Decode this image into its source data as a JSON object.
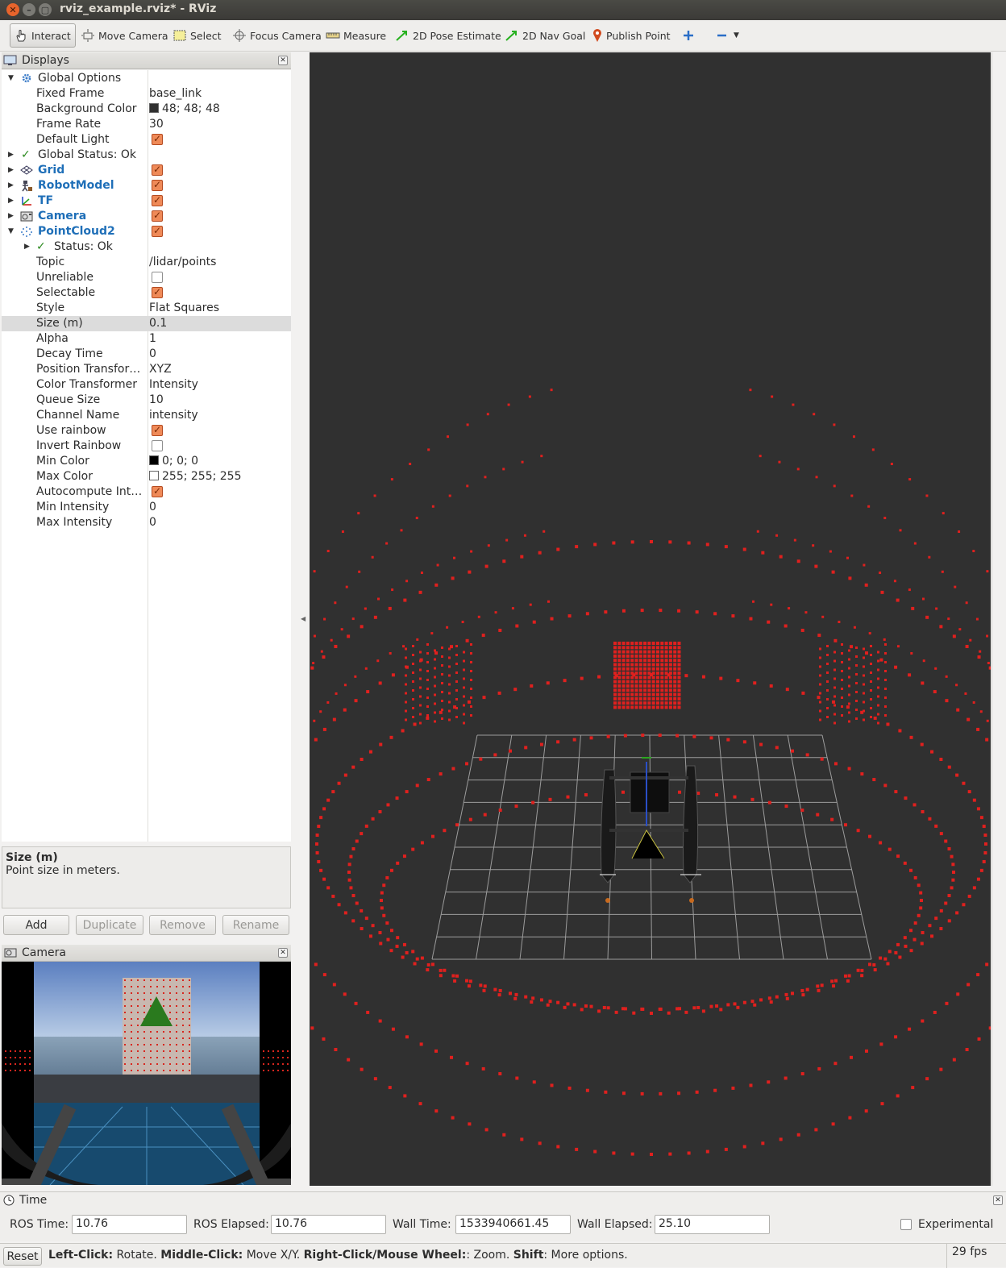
{
  "window": {
    "title": "rviz_example.rviz* - RViz"
  },
  "toolbar": {
    "interact": "Interact",
    "move_camera": "Move Camera",
    "select": "Select",
    "focus_camera": "Focus Camera",
    "measure": "Measure",
    "pose_estimate": "2D Pose Estimate",
    "nav_goal": "2D Nav Goal",
    "publish_point": "Publish Point"
  },
  "displays": {
    "title": "Displays",
    "global_options": "Global Options",
    "fixed_frame_k": "Fixed Frame",
    "fixed_frame_v": "base_link",
    "bg_color_k": "Background Color",
    "bg_color_v": "48; 48; 48",
    "frame_rate_k": "Frame Rate",
    "frame_rate_v": "30",
    "default_light_k": "Default Light",
    "global_status": "Global Status: Ok",
    "grid": "Grid",
    "robot_model": "RobotModel",
    "tf": "TF",
    "camera": "Camera",
    "pointcloud2": "PointCloud2",
    "status": "Status: Ok",
    "topic_k": "Topic",
    "topic_v": "/lidar/points",
    "unreliable_k": "Unreliable",
    "selectable_k": "Selectable",
    "style_k": "Style",
    "style_v": "Flat Squares",
    "size_k": "Size (m)",
    "size_v": "0.1",
    "alpha_k": "Alpha",
    "alpha_v": "1",
    "decay_k": "Decay Time",
    "decay_v": "0",
    "pos_tf_k": "Position Transfor…",
    "pos_tf_v": "XYZ",
    "color_tf_k": "Color Transformer",
    "color_tf_v": "Intensity",
    "queue_k": "Queue Size",
    "queue_v": "10",
    "channel_k": "Channel Name",
    "channel_v": "intensity",
    "rainbow_k": "Use rainbow",
    "invert_k": "Invert Rainbow",
    "min_color_k": "Min Color",
    "min_color_v": "0; 0; 0",
    "max_color_k": "Max Color",
    "max_color_v": "255; 255; 255",
    "autocompute_k": "Autocompute Int…",
    "min_int_k": "Min Intensity",
    "min_int_v": "0",
    "max_int_k": "Max Intensity",
    "max_int_v": "0"
  },
  "help": {
    "title": "Size (m)",
    "text": "Point size in meters."
  },
  "buttons": {
    "add": "Add",
    "duplicate": "Duplicate",
    "remove": "Remove",
    "rename": "Rename"
  },
  "camera_panel": {
    "title": "Camera"
  },
  "time": {
    "title": "Time",
    "ros_time_label": "ROS Time:",
    "ros_time": "10.76",
    "ros_elapsed_label": "ROS Elapsed:",
    "ros_elapsed": "10.76",
    "wall_time_label": "Wall Time:",
    "wall_time": "1533940661.45",
    "wall_elapsed_label": "Wall Elapsed:",
    "wall_elapsed": "25.10",
    "experimental": "Experimental"
  },
  "status": {
    "reset": "Reset",
    "hint_b1": "Left-Click:",
    "hint_t1": " Rotate. ",
    "hint_b2": "Middle-Click:",
    "hint_t2": " Move X/Y. ",
    "hint_b3": "Right-Click/Mouse Wheel:",
    "hint_t3": ": Zoom. ",
    "hint_b4": "Shift",
    "hint_t4": ": More options.",
    "fps": "29 fps"
  },
  "colors": {
    "point": "#e0201e",
    "viewport_bg": "#303030",
    "grid": "#a0a0a0",
    "link_blue": "#1f6fb8",
    "checkbox": "#ef8a58"
  }
}
